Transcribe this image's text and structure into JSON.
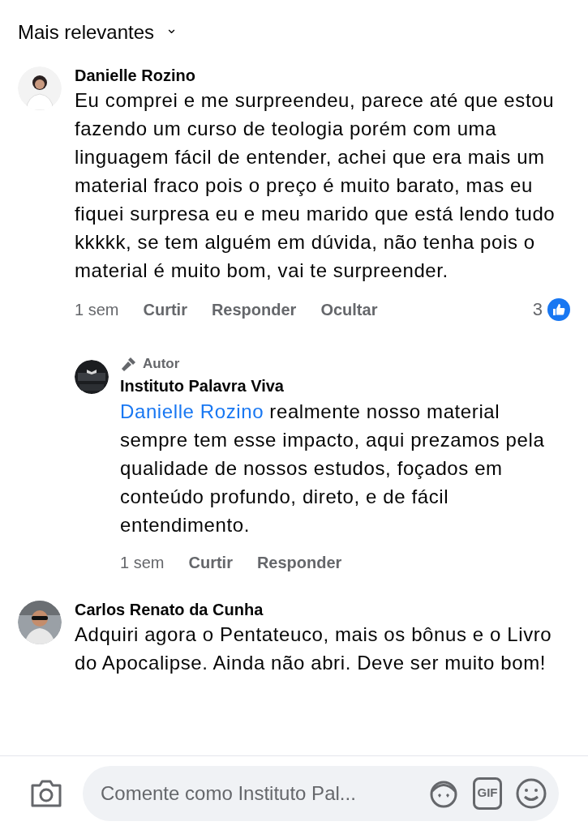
{
  "sort": {
    "label": "Mais relevantes",
    "caret": "⌄"
  },
  "comments": [
    {
      "author": "Danielle Rozino",
      "text": "Eu comprei e me surpreendeu, parece até que estou fazendo um curso de teologia porém com uma linguagem fácil de entender, achei que era mais um material fraco pois o preço é muito barato, mas eu fiquei surpresa eu e meu marido que está lendo tudo kkkkk, se tem alguém em dúvida, não tenha pois o material é muito bom, vai te surpreender.",
      "time": "1 sem",
      "actions": [
        "Curtir",
        "Responder",
        "Ocultar"
      ],
      "likes": "3",
      "replies": [
        {
          "badge": "Autor",
          "author": "Instituto Palavra Viva",
          "mention": "Danielle Rozino",
          "text": "realmente nosso material sempre tem esse impacto, aqui prezamos pela qualidade de nossos estudos, foçados em conteúdo profundo, direto, e de fácil entendimento.",
          "time": "1 sem",
          "actions": [
            "Curtir",
            "Responder"
          ]
        }
      ]
    },
    {
      "author": "Carlos Renato da Cunha",
      "text": "Adquiri agora o Pentateuco, mais os bônus e o Livro do Apocalipse. Ainda não abri. Deve ser muito bom!"
    }
  ],
  "composer": {
    "placeholder": "Comente como Instituto Pal...",
    "gif_label": "GIF"
  }
}
